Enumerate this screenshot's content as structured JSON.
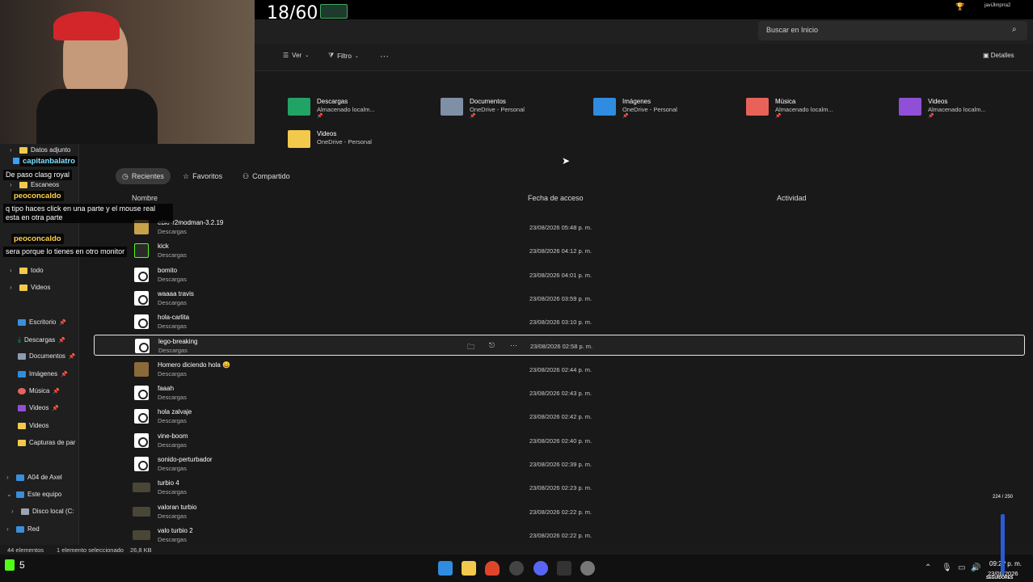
{
  "stream": {
    "counter": "18/60",
    "kick_count": "5",
    "viewer_stat": "224 / 250",
    "followers_label": "SEGUIDORES",
    "top_right_user": "javiJlmprra2"
  },
  "chat": [
    {
      "user": "capitanbalatro",
      "message": "De paso clasg royal"
    },
    {
      "user": "peoconcaldo",
      "message": "q tipo haces click en una parte y el mouse real esta en otra parte"
    },
    {
      "user": "peoconcaldo",
      "message": "sera porque lo tienes en otro monitor"
    }
  ],
  "explorer": {
    "search_placeholder": "Buscar en Inicio",
    "toolbar": {
      "view": "Ver",
      "filter": "Filtro",
      "more": "···",
      "details": "Detalles"
    },
    "sidebar": {
      "items": [
        {
          "label": "Datos adjunto"
        },
        {
          "label": "Escaneos"
        },
        {
          "label": "todo"
        },
        {
          "label": "Videos"
        },
        {
          "label": "Escritorio"
        },
        {
          "label": "Descargas"
        },
        {
          "label": "Documentos"
        },
        {
          "label": "Imágenes"
        },
        {
          "label": "Música"
        },
        {
          "label": "Videos"
        },
        {
          "label": "Videos"
        },
        {
          "label": "Capturas de par"
        },
        {
          "label": "A04 de Axel"
        },
        {
          "label": "Este equipo"
        },
        {
          "label": "Disco local (C:"
        },
        {
          "label": "Red"
        }
      ]
    },
    "quick_access": [
      {
        "name": "Descargas",
        "sub": "Almacenado localm...",
        "color": "#21a366"
      },
      {
        "name": "Documentos",
        "sub": "OneDrive - Personal",
        "color": "#7f8fa6"
      },
      {
        "name": "Imágenes",
        "sub": "OneDrive - Personal",
        "color": "#2f8ce0"
      },
      {
        "name": "Música",
        "sub": "Almacenado localm...",
        "color": "#e8625a"
      },
      {
        "name": "Videos",
        "sub": "Almacenado localm...",
        "color": "#8f4fd6"
      },
      {
        "name": "Videos",
        "sub": "OneDrive - Personal",
        "color": "#f2c94c"
      }
    ],
    "tabs": {
      "recent": "Recientes",
      "favorites": "Favoritos",
      "shared": "Compartido"
    },
    "columns": {
      "name": "Nombre",
      "date": "Fecha de acceso",
      "activity": "Actividad"
    },
    "files": [
      {
        "name": "ebkr-r2modman-3.2.19",
        "loc": "Descargas",
        "date": "23/08/2026 05:48 p. m.",
        "kind": "folder"
      },
      {
        "name": "kick",
        "loc": "Descargas",
        "date": "23/08/2026 04:12 p. m.",
        "kind": "image"
      },
      {
        "name": "bomito",
        "loc": "Descargas",
        "date": "23/08/2026 04:01 p. m.",
        "kind": "audio"
      },
      {
        "name": "waaaa travis",
        "loc": "Descargas",
        "date": "23/08/2026 03:59 p. m.",
        "kind": "audio"
      },
      {
        "name": "hola-carlita",
        "loc": "Descargas",
        "date": "23/08/2026 03:10 p. m.",
        "kind": "audio"
      },
      {
        "name": "lego-breaking",
        "loc": "Descargas",
        "date": "23/08/2026 02:58 p. m.",
        "kind": "audio"
      },
      {
        "name": "Homero diciendo hola 😄",
        "loc": "Descargas",
        "date": "23/08/2026 02:44 p. m.",
        "kind": "image"
      },
      {
        "name": "faaah",
        "loc": "Descargas",
        "date": "23/08/2026 02:43 p. m.",
        "kind": "audio"
      },
      {
        "name": "hola zalvaje",
        "loc": "Descargas",
        "date": "23/08/2026 02:42 p. m.",
        "kind": "audio"
      },
      {
        "name": "vine-boom",
        "loc": "Descargas",
        "date": "23/08/2026 02:40 p. m.",
        "kind": "audio"
      },
      {
        "name": "sonido-perturbador",
        "loc": "Descargas",
        "date": "23/08/2026 02:39 p. m.",
        "kind": "audio"
      },
      {
        "name": "turbio 4",
        "loc": "Descargas",
        "date": "23/08/2026 02:23 p. m.",
        "kind": "video"
      },
      {
        "name": "valoran turbio",
        "loc": "Descargas",
        "date": "23/08/2026 02:22 p. m.",
        "kind": "video"
      },
      {
        "name": "valo turbio 2",
        "loc": "Descargas",
        "date": "23/08/2026 02:22 p. m.",
        "kind": "video"
      }
    ],
    "status": {
      "count": "44 elementos",
      "selection": "1 elemento seleccionado",
      "size": "26,8 KB"
    }
  },
  "taskbar": {
    "time": "09:2? p. m.",
    "date": "23/08/2026"
  }
}
